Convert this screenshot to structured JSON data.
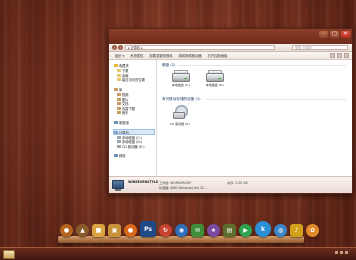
{
  "window": {
    "title": "",
    "controls": {
      "minimize": "–",
      "maximize": "□",
      "close": "✕"
    },
    "address": "▸ 计算机 ▸",
    "search_placeholder": "搜索 计算机"
  },
  "toolbar": {
    "items": [
      "组织 ▾",
      "系统属性",
      "卸载或更改程序",
      "映射网络驱动器",
      "打开控制面板"
    ]
  },
  "sidebar": {
    "favorites": {
      "label": "收藏夹",
      "items": [
        "下载",
        "桌面",
        "最近访问的位置"
      ]
    },
    "libraries": {
      "label": "库",
      "items": [
        "视频",
        "图片",
        "文档",
        "迅雷下载",
        "音乐"
      ]
    },
    "homegroup": {
      "label": "家庭组"
    },
    "computer": {
      "label": "计算机",
      "items": [
        "本地磁盘 (C:)",
        "本地磁盘 (D:)",
        "CD 驱动器 (E:)"
      ]
    },
    "network": {
      "label": "网络"
    }
  },
  "content": {
    "hdd_group": "硬盘 (2)",
    "removable_group": "有可移动存储的设备 (1)",
    "drives": [
      {
        "label": "本地磁盘 (C:)"
      },
      {
        "label": "本地磁盘 (D:)"
      }
    ],
    "dvd": {
      "label": "CD 驱动器 (E:)"
    }
  },
  "statusbar": {
    "computer_name": "WINSEVENSTYLE",
    "workgroup": "工作组: WORKGROUP",
    "processor": "处理器: AMD Sempron(tm) 32...",
    "memory": "内存: 2.00 GB"
  },
  "dock": {
    "icons": [
      {
        "name": "acorn-icon",
        "glyph": "●",
        "color": "#b5651d",
        "round": true
      },
      {
        "name": "stump-icon",
        "glyph": "▲",
        "color": "#8b5a2b",
        "round": true
      },
      {
        "name": "folder-icon",
        "glyph": "■",
        "color": "#d9a441",
        "round": false
      },
      {
        "name": "picture-icon",
        "glyph": "▣",
        "color": "#c9923a",
        "round": false
      },
      {
        "name": "pumpkin-icon",
        "glyph": "●",
        "color": "#d86a1e",
        "round": true
      },
      {
        "name": "photoshop-icon",
        "glyph": "Ps",
        "color": "#1f4a85",
        "round": false
      },
      {
        "name": "sync-icon",
        "glyph": "↻",
        "color": "#c8432e",
        "round": true
      },
      {
        "name": "browser-icon",
        "glyph": "◉",
        "color": "#2f6fb5",
        "round": true
      },
      {
        "name": "mail-icon",
        "glyph": "✉",
        "color": "#3f8f3a",
        "round": false
      },
      {
        "name": "star-icon",
        "glyph": "★",
        "color": "#7a4a9e",
        "round": true
      },
      {
        "name": "tab-icon",
        "glyph": "▤",
        "color": "#5d6e2d",
        "round": false
      },
      {
        "name": "play-icon",
        "glyph": "▶",
        "color": "#2ea44f",
        "round": true
      },
      {
        "name": "k-icon",
        "glyph": "k",
        "color": "#2b8fd6",
        "round": true
      },
      {
        "name": "globe-icon",
        "glyph": "◍",
        "color": "#3d87c9",
        "round": true
      },
      {
        "name": "bell-icon",
        "glyph": "♪",
        "color": "#d4a21a",
        "round": false
      },
      {
        "name": "flower-icon",
        "glyph": "✿",
        "color": "#e08a2a",
        "round": true
      }
    ]
  },
  "taskbar": {
    "clock": ""
  }
}
